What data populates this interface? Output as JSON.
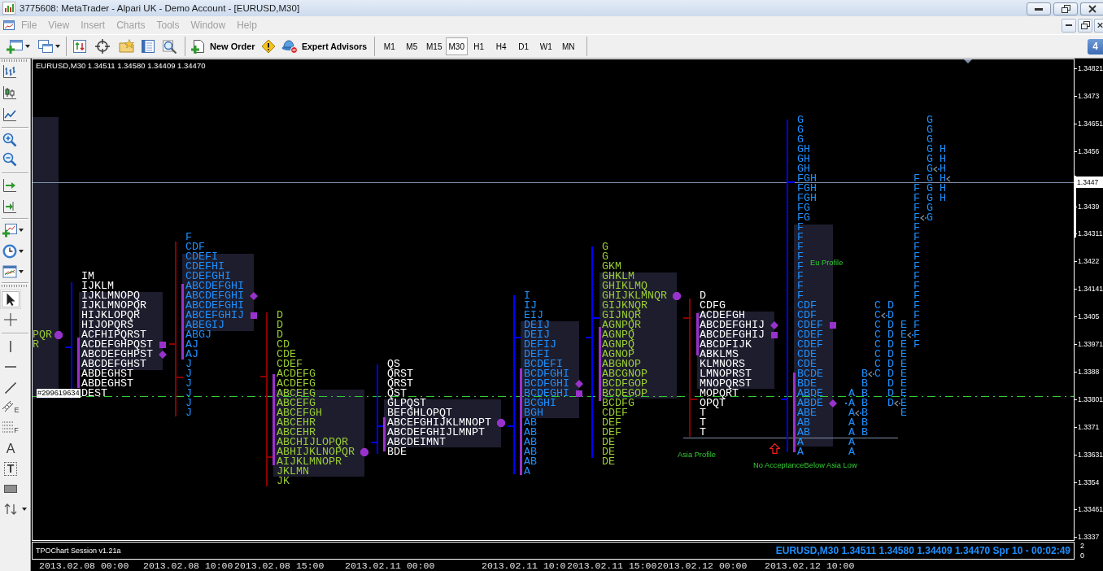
{
  "window": {
    "title": "3775608: MetaTrader - Alpari UK - Demo Account - [EURUSD,M30]"
  },
  "menu": [
    {
      "label": "File",
      "disabled": true
    },
    {
      "label": "View",
      "disabled": true
    },
    {
      "label": "Insert",
      "disabled": true
    },
    {
      "label": "Charts",
      "disabled": true
    },
    {
      "label": "Tools",
      "disabled": true
    },
    {
      "label": "Window",
      "disabled": true
    },
    {
      "label": "Help",
      "disabled": true
    }
  ],
  "toolbar": {
    "buttons": [
      {
        "label": "New Order"
      },
      {
        "label": "Expert Advisors"
      }
    ],
    "timeframes": [
      {
        "label": "M1",
        "selected": false
      },
      {
        "label": "M5",
        "selected": false
      },
      {
        "label": "M15",
        "selected": false
      },
      {
        "label": "M30",
        "selected": true
      },
      {
        "label": "H1",
        "selected": false
      },
      {
        "label": "H4",
        "selected": false
      },
      {
        "label": "D1",
        "selected": false
      },
      {
        "label": "W1",
        "selected": false
      },
      {
        "label": "MN",
        "selected": false
      }
    ],
    "messages": "4"
  },
  "drawing_tools": [
    {
      "selected": true
    },
    {
      "selected": false
    },
    {
      "selected": false
    },
    {
      "selected": false
    },
    {
      "selected": false
    },
    {
      "selected": false,
      "glyph": "E"
    },
    {
      "selected": false,
      "glyph": "F"
    },
    {
      "selected": false,
      "glyph": "A"
    },
    {
      "selected": false,
      "glyph": "T"
    },
    {
      "selected": false
    },
    {
      "selected": false
    }
  ],
  "chart": {
    "header": "EURUSD,M30 1.34511 1.34580 1.34409 1.34470",
    "order_label": "#299619634",
    "profiles": [
      {
        "color": "#9acd32",
        "rows": [
          {
            "text": "PQR",
            "kind": "circle"
          },
          {
            "text": "R",
            "kind": "plain"
          }
        ]
      },
      {
        "color": "#ffffff",
        "range": {
          "color": "#0000ff"
        },
        "rows": [
          {
            "text": "IM",
            "kind": "plain"
          },
          {
            "text": "IJKLM",
            "kind": "plain"
          },
          {
            "text": "IJKLMNOPQ",
            "kind": "plain"
          },
          {
            "text": "IJKLMNOPQR",
            "kind": "plain"
          },
          {
            "text": "HIJKLOPQR",
            "kind": "plain"
          },
          {
            "text": "HIJOPQRS",
            "kind": "plain"
          },
          {
            "text": "ACFHIPQRST",
            "kind": "plain"
          },
          {
            "text": "ACDEFGHPQST",
            "kind": "square"
          },
          {
            "text": "ABCDEFGHPST",
            "kind": "diamond"
          },
          {
            "text": "ABCDEFGHST",
            "kind": "plain"
          },
          {
            "text": "ABDEGHST",
            "kind": "plain"
          },
          {
            "text": "ABDEGHST",
            "kind": "plain"
          },
          {
            "text": "DEST",
            "kind": "plain"
          }
        ]
      },
      {
        "color": "#1e90ff",
        "range": {
          "color": "#8b0000"
        },
        "rows": [
          {
            "text": "F",
            "kind": "plain"
          },
          {
            "text": "CDF",
            "kind": "plain"
          },
          {
            "text": "CDEFI",
            "kind": "plain"
          },
          {
            "text": "CDEFHI",
            "kind": "plain"
          },
          {
            "text": "CDEFGHI",
            "kind": "plain"
          },
          {
            "text": "ABCDEFGHI",
            "kind": "plain"
          },
          {
            "text": "ABCDEFGHI",
            "kind": "diamond"
          },
          {
            "text": "ABCDEFGHI",
            "kind": "plain"
          },
          {
            "text": "ABCEFGHIJ",
            "kind": "square"
          },
          {
            "text": "ABEGIJ",
            "kind": "plain"
          },
          {
            "text": "ABGJ",
            "kind": "plain"
          },
          {
            "text": "AJ",
            "kind": "plain"
          },
          {
            "text": "AJ",
            "kind": "plain"
          },
          {
            "text": "J",
            "kind": "plain"
          },
          {
            "text": "J",
            "kind": "plain"
          },
          {
            "text": "J",
            "kind": "plain"
          },
          {
            "text": "J",
            "kind": "plain"
          },
          {
            "text": "J",
            "kind": "plain"
          },
          {
            "text": "J",
            "kind": "plain"
          }
        ]
      },
      {
        "color": "#9acd32",
        "range": {
          "color": "#8b0000"
        },
        "rows": [
          {
            "text": "D",
            "kind": "plain"
          },
          {
            "text": "D",
            "kind": "plain"
          },
          {
            "text": "D",
            "kind": "plain"
          },
          {
            "text": "CD",
            "kind": "plain"
          },
          {
            "text": "CDE",
            "kind": "plain"
          },
          {
            "text": "CDEF",
            "kind": "plain"
          },
          {
            "text": "ACDEFG",
            "kind": "plain"
          },
          {
            "text": "ACDEFG",
            "kind": "plain"
          },
          {
            "text": "ABCEFG",
            "kind": "plain"
          },
          {
            "text": "ABCEFG",
            "kind": "plain"
          },
          {
            "text": "ABCEFGH",
            "kind": "plain"
          },
          {
            "text": "ABCEHR",
            "kind": "plain"
          },
          {
            "text": "ABCEHR",
            "kind": "plain"
          },
          {
            "text": "ABCHIJLOPQR",
            "kind": "plain"
          },
          {
            "text": "ABHIJKLNOPQR",
            "kind": "circle"
          },
          {
            "text": "AIJKLMNOPR",
            "kind": "plain"
          },
          {
            "text": "JKLMN",
            "kind": "plain"
          },
          {
            "text": "JK",
            "kind": "plain"
          }
        ]
      },
      {
        "color": "#ffffff",
        "range": {
          "color": "#0000ff"
        },
        "rows": [
          {
            "text": "QS",
            "kind": "plain"
          },
          {
            "text": "QRST",
            "kind": "plain"
          },
          {
            "text": "QRST",
            "kind": "plain"
          },
          {
            "text": "QST",
            "kind": "plain"
          },
          {
            "text": "GLPQST",
            "kind": "plain"
          },
          {
            "text": "BEFGHLOPQT",
            "kind": "plain"
          },
          {
            "text": "ABCEFGHIJKLMNOPT",
            "kind": "circle"
          },
          {
            "text": "ABCDEFGHIJLMNPT",
            "kind": "plain"
          },
          {
            "text": "ABCDEIMNT",
            "kind": "plain"
          },
          {
            "text": "BDE",
            "kind": "plain"
          }
        ]
      },
      {
        "color": "#1e90ff",
        "range": {
          "color": "#0000ff"
        },
        "rows": [
          {
            "text": "I",
            "kind": "plain"
          },
          {
            "text": "IJ",
            "kind": "plain"
          },
          {
            "text": "EIJ",
            "kind": "plain"
          },
          {
            "text": "DEIJ",
            "kind": "plain"
          },
          {
            "text": "DEIJ",
            "kind": "plain"
          },
          {
            "text": "DEFIJ",
            "kind": "plain"
          },
          {
            "text": "DEFI",
            "kind": "plain"
          },
          {
            "text": "BCDEFI",
            "kind": "plain"
          },
          {
            "text": "BCDFGHI",
            "kind": "plain"
          },
          {
            "text": "BCDFGHI",
            "kind": "diamond"
          },
          {
            "text": "BCDEGHI",
            "kind": "square"
          },
          {
            "text": "BCGHI",
            "kind": "plain"
          },
          {
            "text": "BGH",
            "kind": "plain"
          },
          {
            "text": "AB",
            "kind": "plain"
          },
          {
            "text": "AB",
            "kind": "plain"
          },
          {
            "text": "AB",
            "kind": "plain"
          },
          {
            "text": "AB",
            "kind": "plain"
          },
          {
            "text": "AB",
            "kind": "plain"
          },
          {
            "text": "A",
            "kind": "plain"
          }
        ]
      },
      {
        "color": "#9acd32",
        "range": {
          "color": "#0000ff"
        },
        "rows": [
          {
            "text": "G",
            "kind": "plain"
          },
          {
            "text": "G",
            "kind": "plain"
          },
          {
            "text": "GKM",
            "kind": "plain"
          },
          {
            "text": "GHKLM",
            "kind": "plain"
          },
          {
            "text": "GHIKLMQ",
            "kind": "plain"
          },
          {
            "text": "GHIJKLMNQR",
            "kind": "circle"
          },
          {
            "text": "GIJKNQR",
            "kind": "plain"
          },
          {
            "text": "GIJNQR",
            "kind": "plain"
          },
          {
            "text": "AGNPQR",
            "kind": "plain"
          },
          {
            "text": "AGNPQ",
            "kind": "plain"
          },
          {
            "text": "AGNPQ",
            "kind": "plain"
          },
          {
            "text": "AGNOP",
            "kind": "plain"
          },
          {
            "text": "ABGNOP",
            "kind": "plain"
          },
          {
            "text": "ABCGNOP",
            "kind": "plain"
          },
          {
            "text": "BCDFGOP",
            "kind": "plain"
          },
          {
            "text": "BCDEGOP",
            "kind": "plain"
          },
          {
            "text": "BCDFG",
            "kind": "plain"
          },
          {
            "text": "CDEF",
            "kind": "plain"
          },
          {
            "text": "DEF",
            "kind": "plain"
          },
          {
            "text": "DEF",
            "kind": "plain"
          },
          {
            "text": "DE",
            "kind": "plain"
          },
          {
            "text": "DE",
            "kind": "plain"
          },
          {
            "text": "DE",
            "kind": "plain"
          }
        ]
      },
      {
        "color": "#ffffff",
        "range": {
          "color": "#8b0000"
        },
        "rows": [
          {
            "text": "D",
            "kind": "plain"
          },
          {
            "text": "CDFG",
            "kind": "plain"
          },
          {
            "text": "ACDEFGH",
            "kind": "plain"
          },
          {
            "text": "ABCDEFGHIJ",
            "kind": "diamond"
          },
          {
            "text": "ABCDEFGHIJ",
            "kind": "square"
          },
          {
            "text": "ABCDFIJK",
            "kind": "plain"
          },
          {
            "text": "ABKLMS",
            "kind": "plain"
          },
          {
            "text": "KLMNORS",
            "kind": "plain"
          },
          {
            "text": "LMNOPRST",
            "kind": "plain"
          },
          {
            "text": "MNOPQRST",
            "kind": "plain"
          },
          {
            "text": "MOPQRT",
            "kind": "plain"
          },
          {
            "text": "OPQT",
            "kind": "plain"
          },
          {
            "text": "T",
            "kind": "plain"
          },
          {
            "text": "T",
            "kind": "plain"
          },
          {
            "text": "T",
            "kind": "plain"
          }
        ]
      },
      {
        "color": "#1e90ff",
        "range": {
          "color": "#0000ff"
        },
        "rows": [
          {
            "text": "G",
            "kind": "plain"
          },
          {
            "text": "G",
            "kind": "plain"
          },
          {
            "text": "G",
            "kind": "plain"
          },
          {
            "text": "GH",
            "kind": "plain"
          },
          {
            "text": "GH",
            "kind": "plain"
          },
          {
            "text": "GH",
            "kind": "plain"
          },
          {
            "text": "FGH",
            "kind": "plain"
          },
          {
            "text": "FGH",
            "kind": "plain"
          },
          {
            "text": "FGH",
            "kind": "plain"
          },
          {
            "text": "FG",
            "kind": "plain"
          },
          {
            "text": "FG",
            "kind": "plain"
          },
          {
            "text": "F",
            "kind": "plain"
          },
          {
            "text": "F",
            "kind": "plain"
          },
          {
            "text": "F",
            "kind": "plain"
          },
          {
            "text": "F",
            "kind": "plain"
          },
          {
            "text": "F",
            "kind": "plain"
          },
          {
            "text": "F",
            "kind": "plain"
          },
          {
            "text": "F",
            "kind": "plain"
          },
          {
            "text": "F",
            "kind": "plain"
          },
          {
            "text": "CDF",
            "kind": "plain"
          },
          {
            "text": "CDF",
            "kind": "plain"
          },
          {
            "text": "CDEF",
            "kind": "square"
          },
          {
            "text": "CDEF",
            "kind": "plain"
          },
          {
            "text": "CDEF",
            "kind": "plain"
          },
          {
            "text": "CDE",
            "kind": "plain"
          },
          {
            "text": "CDE",
            "kind": "plain"
          },
          {
            "text": "BCDE",
            "kind": "plain"
          },
          {
            "text": "BDE",
            "kind": "plain"
          },
          {
            "text": "ABDE",
            "kind": "plain"
          },
          {
            "text": "ABDE",
            "kind": "diamond"
          },
          {
            "text": "ABE",
            "kind": "plain"
          },
          {
            "text": "AB",
            "kind": "plain"
          },
          {
            "text": "AB",
            "kind": "plain"
          },
          {
            "text": "A",
            "kind": "plain"
          },
          {
            "text": "A",
            "kind": "plain"
          }
        ]
      }
    ],
    "split_profile": {
      "columns": [
        {
          "letters": [
            "A",
            "A",
            "A",
            "A",
            "A",
            "A",
            "A"
          ]
        },
        {
          "letters": [
            "B",
            "B",
            "B",
            "B",
            "B",
            "B",
            "B"
          ]
        },
        {
          "letters": [
            "C",
            "C",
            "C",
            "C",
            "C",
            "C",
            "C",
            "C"
          ]
        },
        {
          "letters": [
            "D",
            "D",
            "D",
            "D",
            "D",
            "D",
            "D",
            "D",
            "D",
            "D",
            "D"
          ]
        },
        {
          "letters": [
            "E",
            "E",
            "E",
            "E",
            "E",
            "E",
            "E",
            "E",
            "E",
            "E"
          ]
        },
        {
          "letters": [
            "F",
            "F",
            "F",
            "F",
            "F",
            "F",
            "F",
            "F",
            "F",
            "F",
            "F",
            "F",
            "F",
            "F",
            "F",
            "F",
            "F",
            "F"
          ]
        },
        {
          "letters": [
            "G",
            "G",
            "G",
            "G",
            "G",
            "G",
            "G",
            "G",
            "G",
            "G",
            "G"
          ]
        },
        {
          "letters": [
            "H",
            "H",
            "H",
            "H",
            "H",
            "H"
          ]
        }
      ]
    },
    "labels": [
      "Eu Profile",
      "Asia Profile",
      "No AcceptanceBelow Asia Low"
    ]
  },
  "price_axis": {
    "labels": [
      "1.34821",
      "1.3473",
      "1.34651",
      "1.3456",
      "1.3439",
      "1.34311",
      "1.3422",
      "1.34141",
      "1.3405",
      "1.33971",
      "1.3388",
      "1.33801",
      "1.3371",
      "1.33631",
      "1.3354",
      "1.33461",
      "1.3337"
    ],
    "current": "1.3447"
  },
  "indicator_window": {
    "title": "TPOChart Session v1.21a",
    "quote": "EURUSD,M30 1.34511 1.34580 1.34409 1.34470 Spr 10 - 00:02:49",
    "scale": [
      "2",
      "0"
    ]
  },
  "time_axis": [
    "2013.02.08 00:00",
    "2013.02.08 10:00",
    "2013.02.08 15:00",
    "2013.02.11 00:00",
    "2013.02.11 10:0",
    "2013.02.11 15:00",
    "2013.02.12 00:00",
    "2013.02.12 10:00"
  ]
}
